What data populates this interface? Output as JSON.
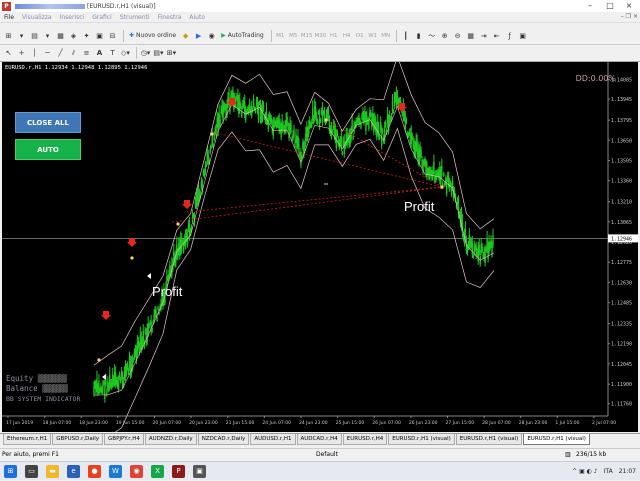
{
  "window": {
    "app_icon": "P",
    "title": "[EURUSD.r,H1 (visual)]"
  },
  "menu": {
    "items": [
      "File",
      "Visualizza",
      "Inserisci",
      "Grafici",
      "Strumenti",
      "Finestra",
      "Aiuto"
    ]
  },
  "toolbar": {
    "new_order_label": "Nuovo ordine",
    "autotrading_label": "AutoTrading",
    "timeframes": [
      "M1",
      "M5",
      "M15",
      "M30",
      "H1",
      "H4",
      "D1",
      "W1",
      "MN"
    ]
  },
  "chart": {
    "header": "EURUSD.r,H1  1.12934 1.12948 1.12895 1.12946",
    "dd_label": "DD:0.00%",
    "close_all_label": "CLOSE ALL",
    "auto_label": "AUTO",
    "profit_label_1": "Profit",
    "profit_label_2": "Profit",
    "equity_label": "Equity",
    "balance_label": "Balance",
    "indicator_label": "BB SYSTEM INDICATOR",
    "colors": {
      "background": "#000000",
      "candles": "#1ec81e",
      "bands": "#e8c8c8",
      "arrows": "#e8261e",
      "trade_lines": "#c81e1e"
    }
  },
  "chart_data": {
    "type": "line",
    "title": "EURUSD.r,H1",
    "xlabel": "",
    "ylabel": "",
    "x": [
      "17 Jun 2019",
      "18 Jun 07:00",
      "18 Jun 23:00",
      "19 Jun 15:00",
      "20 Jun 07:00",
      "20 Jun 23:00",
      "21 Jun 15:00",
      "24 Jun 07:00",
      "24 Jun 23:00",
      "25 Jun 15:00",
      "26 Jun 07:00",
      "26 Jun 23:00",
      "27 Jun 15:00",
      "28 Jun 07:00",
      "28 Jun 23:00",
      "1 Jul 15:00",
      "2 Jul 07:00"
    ],
    "y_ticks": [
      "1.14085",
      "1.13945",
      "1.13795",
      "1.13650",
      "1.13505",
      "1.13360",
      "1.13210",
      "1.13065",
      "1.12920",
      "1.12775",
      "1.12630",
      "1.12485",
      "1.12335",
      "1.12190",
      "1.12045",
      "1.11900",
      "1.11760"
    ],
    "current_price": "1.12946",
    "ylim": [
      1.117,
      1.1414
    ],
    "series": [
      {
        "values": [
          1.1185,
          1.1188,
          1.1192,
          1.121,
          1.1228,
          1.1248,
          1.1285,
          1.13,
          1.134,
          1.1378,
          1.1395,
          1.1385,
          1.1388,
          1.1372,
          1.1375,
          1.1355,
          1.1382,
          1.1378,
          1.136,
          1.1375,
          1.138,
          1.1368,
          1.1395,
          1.1365,
          1.1345,
          1.134,
          1.133,
          1.129,
          1.1282,
          1.129
        ]
      }
    ]
  },
  "tabs": [
    "Ethereum.r,H1",
    "GBPUSD.r,Daily",
    "GBPJPY.r,H4",
    "AUDNZD.r,Daily",
    "NZDCAD.r,Daily",
    "AUDUSD.r,H1",
    "AUDCAD.r,H4",
    "EURUSD.r,H4",
    "EURUSD.r,H1 (visual)",
    "EURUSD.r,H1 (visual)",
    "EURUSD.r,H1 (visual)"
  ],
  "status": {
    "help": "Per aiuto, premi F1",
    "profile": "Default",
    "traffic": "236/15 kb",
    "lang": "ITA",
    "time": "21:07"
  }
}
